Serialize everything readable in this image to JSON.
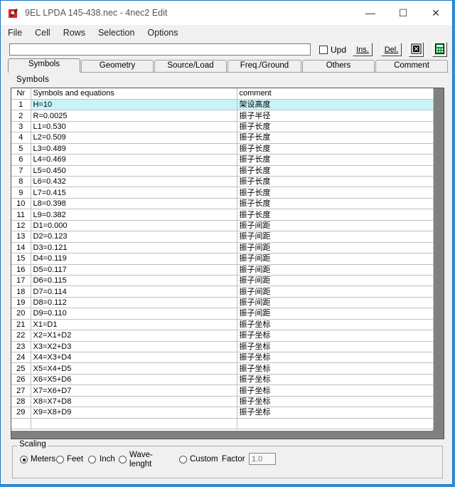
{
  "window": {
    "title": "9EL LPDA 145-438.nec - 4nec2 Edit",
    "controls": {
      "minimize": "—",
      "maximize": "☐",
      "close": "✕"
    }
  },
  "menu": [
    "File",
    "Cell",
    "Rows",
    "Selection",
    "Options"
  ],
  "toolbar": {
    "equation_value": "",
    "upd_label": "Upd",
    "upd_checked": false,
    "ins_label": "Ins.",
    "del_label": "Del."
  },
  "tabs": [
    "Symbols",
    "Geometry",
    "Source/Load",
    "Freq./Ground",
    "Others",
    "Comment"
  ],
  "active_tab": "Symbols",
  "panel_title": "Symbols",
  "grid": {
    "headers": {
      "nr": "Nr",
      "eq": "Symbols and equations",
      "comment": "comment"
    },
    "rows": [
      {
        "nr": "1",
        "eq": "H=10",
        "comment": "架设高度"
      },
      {
        "nr": "2",
        "eq": "R=0.0025",
        "comment": "振子半径"
      },
      {
        "nr": "3",
        "eq": "L1=0.530",
        "comment": "振子长度"
      },
      {
        "nr": "4",
        "eq": "L2=0.509",
        "comment": "振子长度"
      },
      {
        "nr": "5",
        "eq": "L3=0.489",
        "comment": "振子长度"
      },
      {
        "nr": "6",
        "eq": "L4=0.469",
        "comment": "振子长度"
      },
      {
        "nr": "7",
        "eq": "L5=0.450",
        "comment": "振子长度"
      },
      {
        "nr": "8",
        "eq": "L6=0.432",
        "comment": "振子长度"
      },
      {
        "nr": "9",
        "eq": "L7=0.415",
        "comment": "振子长度"
      },
      {
        "nr": "10",
        "eq": "L8=0.398",
        "comment": "振子长度"
      },
      {
        "nr": "11",
        "eq": "L9=0.382",
        "comment": "振子长度"
      },
      {
        "nr": "12",
        "eq": "D1=0.000",
        "comment": "振子间距"
      },
      {
        "nr": "13",
        "eq": "D2=0.123",
        "comment": "振子间距"
      },
      {
        "nr": "14",
        "eq": "D3=0.121",
        "comment": "振子间距"
      },
      {
        "nr": "15",
        "eq": "D4=0.119",
        "comment": "振子间距"
      },
      {
        "nr": "16",
        "eq": "D5=0.117",
        "comment": "振子间距"
      },
      {
        "nr": "17",
        "eq": "D6=0.115",
        "comment": "振子间距"
      },
      {
        "nr": "18",
        "eq": "D7=0.114",
        "comment": "振子间距"
      },
      {
        "nr": "19",
        "eq": "D8=0.112",
        "comment": "振子间距"
      },
      {
        "nr": "20",
        "eq": "D9=0.110",
        "comment": "振子间距"
      },
      {
        "nr": "21",
        "eq": "X1=D1",
        "comment": "振子坐标"
      },
      {
        "nr": "22",
        "eq": "X2=X1+D2",
        "comment": "振子坐标"
      },
      {
        "nr": "23",
        "eq": "X3=X2+D3",
        "comment": "振子坐标"
      },
      {
        "nr": "24",
        "eq": "X4=X3+D4",
        "comment": "振子坐标"
      },
      {
        "nr": "25",
        "eq": "X5=X4+D5",
        "comment": "振子坐标"
      },
      {
        "nr": "26",
        "eq": "X6=X5+D6",
        "comment": "振子坐标"
      },
      {
        "nr": "27",
        "eq": "X7=X6+D7",
        "comment": "振子坐标"
      },
      {
        "nr": "28",
        "eq": "X8=X7+D8",
        "comment": "振子坐标"
      },
      {
        "nr": "29",
        "eq": "X9=X8+D9",
        "comment": "振子坐标"
      },
      {
        "nr": "",
        "eq": "",
        "comment": ""
      }
    ],
    "selected_row": "1"
  },
  "scaling": {
    "title": "Scaling",
    "options": [
      "Meters",
      "Feet",
      "Inch",
      "Wave-\nlenght",
      "Custom"
    ],
    "selected": "Meters",
    "factor_label": "Factor",
    "factor_value": "1.0"
  },
  "colors": {
    "selection": "#c8f4f8",
    "grid_background": "#808080",
    "desktop": "#2f8fd0"
  }
}
